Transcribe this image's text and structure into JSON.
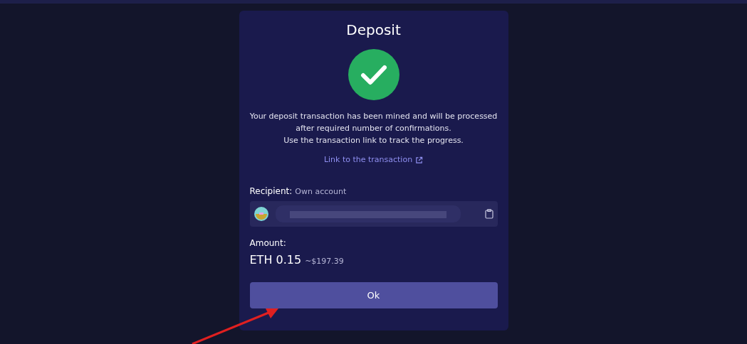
{
  "dialog": {
    "title": "Deposit",
    "succeeded": true,
    "message_lines": [
      "Your deposit transaction has been mined and will be processed",
      "after required number of confirmations.",
      "Use the transaction link to track the progress."
    ],
    "link": "Link to the transaction",
    "recipient": {
      "label": "Recipient:",
      "note": "Own account"
    },
    "amount": {
      "label": "Amount:",
      "value": "ETH 0.15",
      "fiat": "~$197.39"
    },
    "button": "Ok"
  }
}
